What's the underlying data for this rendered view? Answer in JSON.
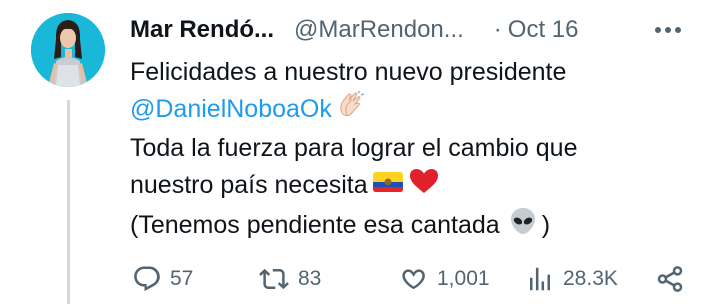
{
  "tweet": {
    "author_name": "Mar Rendó...",
    "author_handle": "@MarRendon...",
    "separator": "·",
    "date": "Oct 16",
    "lines": {
      "line1": "Felicidades a nuestro nuevo presidente",
      "mention": "@DanielNoboaOk",
      "line3": "Toda la fuerza para lograr el cambio que",
      "line4": "nuestro país necesita",
      "line5_text": "(Tenemos pendiente esa cantada",
      "line5_close": ")"
    },
    "emojis": [
      "clapping-hands-emoji",
      "ecuador-flag-emoji",
      "red-heart-emoji",
      "alien-emoji"
    ]
  },
  "actions": {
    "replies": "57",
    "reposts": "83",
    "likes": "1,001",
    "views": "28.3K"
  },
  "colors": {
    "text": "#0f1419",
    "secondary": "#536471",
    "mention": "#1d9bf0",
    "thread_line": "#cfd9de"
  }
}
